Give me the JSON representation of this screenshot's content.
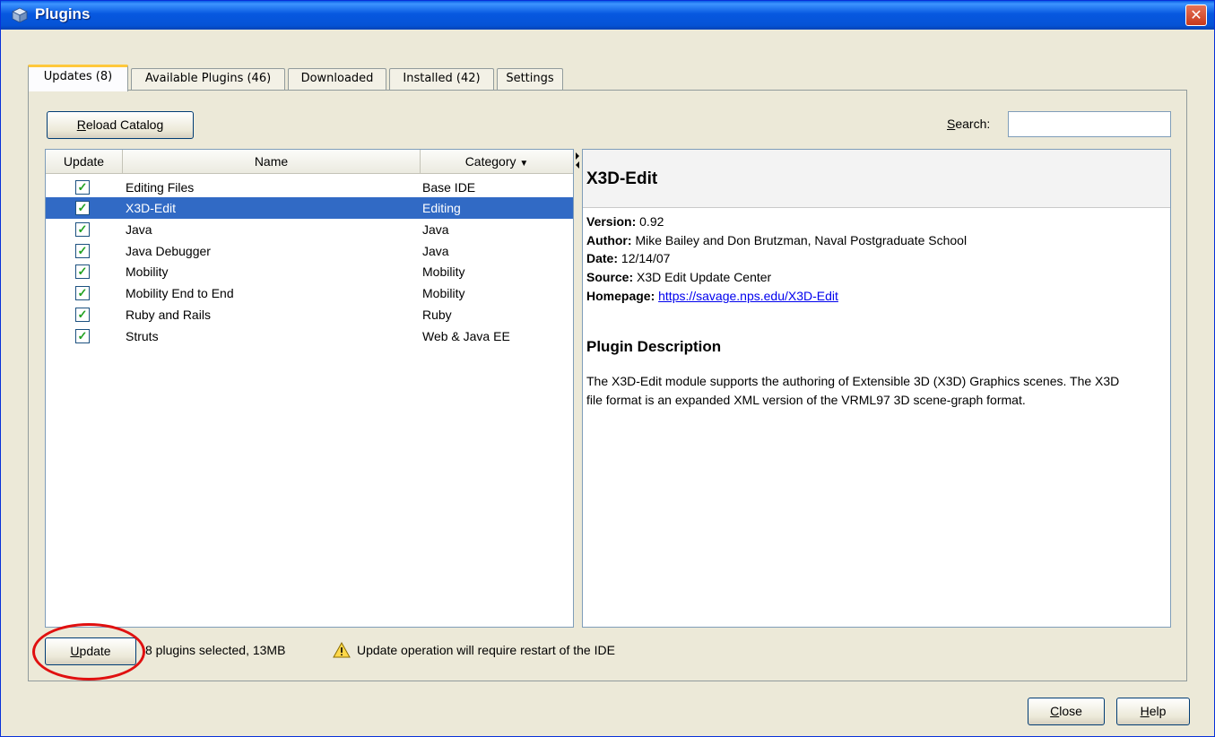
{
  "window": {
    "title": "Plugins",
    "close_glyph": "✕",
    "accent": "#0553d6"
  },
  "tabs": [
    {
      "label": "Updates (8)",
      "active": true
    },
    {
      "label": "Available Plugins (46)",
      "active": false
    },
    {
      "label": "Downloaded",
      "active": false
    },
    {
      "label": "Installed (42)",
      "active": false
    },
    {
      "label": "Settings",
      "active": false
    }
  ],
  "toolbar": {
    "reload_prefix": "R",
    "reload_rest": "eload Catalog",
    "search_prefix": "S",
    "search_rest": "earch:",
    "search_value": ""
  },
  "table": {
    "headers": {
      "update": "Update",
      "name": "Name",
      "category": "Category",
      "sort_glyph": "▼"
    },
    "rows": [
      {
        "checked": true,
        "name": "Editing Files",
        "category": "Base IDE",
        "selected": false
      },
      {
        "checked": true,
        "name": "X3D-Edit",
        "category": "Editing",
        "selected": true
      },
      {
        "checked": true,
        "name": "Java",
        "category": "Java",
        "selected": false
      },
      {
        "checked": true,
        "name": "Java Debugger",
        "category": "Java",
        "selected": false
      },
      {
        "checked": true,
        "name": "Mobility",
        "category": "Mobility",
        "selected": false
      },
      {
        "checked": true,
        "name": "Mobility End to End",
        "category": "Mobility",
        "selected": false
      },
      {
        "checked": true,
        "name": "Ruby and Rails",
        "category": "Ruby",
        "selected": false
      },
      {
        "checked": true,
        "name": "Struts",
        "category": "Web & Java EE",
        "selected": false
      }
    ],
    "check_glyph": "✓",
    "selection_color": "#316ac5"
  },
  "detail": {
    "title": "X3D-Edit",
    "version_label": "Version:",
    "version": "0.92",
    "author_label": "Author:",
    "author": "Mike Bailey and Don Brutzman, Naval Postgraduate School",
    "date_label": "Date:",
    "date": "12/14/07",
    "source_label": "Source:",
    "source": "X3D Edit Update Center",
    "homepage_label": "Homepage:",
    "homepage": "https://savage.nps.edu/X3D-Edit",
    "description_title": "Plugin Description",
    "description": "The X3D-Edit module supports the authoring of Extensible 3D (X3D) Graphics scenes. The X3D file format is an expanded XML version of the VRML97 3D scene-graph format."
  },
  "footer": {
    "update_prefix": "U",
    "update_rest": "pdate",
    "status": "8 plugins selected, 13MB",
    "warning": "Update operation will require restart of the IDE",
    "close_prefix": "C",
    "close_rest": "lose",
    "help_prefix": "H",
    "help_rest": "elp",
    "highlight_color": "#e01010"
  }
}
